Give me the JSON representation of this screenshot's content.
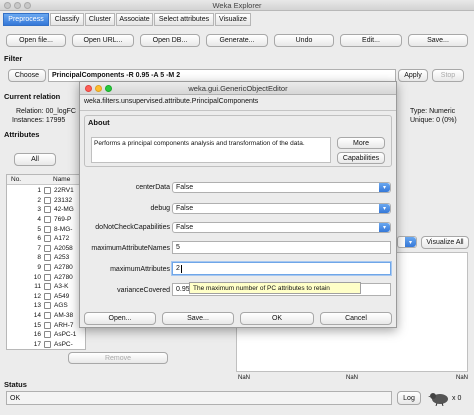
{
  "window_title": "Weka Explorer",
  "tabs": [
    {
      "label": "Preprocess",
      "active": true
    },
    {
      "label": "Classify"
    },
    {
      "label": "Cluster"
    },
    {
      "label": "Associate"
    },
    {
      "label": "Select attributes"
    },
    {
      "label": "Visualize"
    }
  ],
  "toolbar": {
    "open_file": "Open file...",
    "open_url": "Open URL...",
    "open_db": "Open DB...",
    "generate": "Generate...",
    "undo": "Undo",
    "edit": "Edit...",
    "save": "Save..."
  },
  "filter": {
    "section": "Filter",
    "choose": "Choose",
    "value": "PrincipalComponents -R 0.95 -A 5 -M 2",
    "apply": "Apply",
    "stop": "Stop"
  },
  "current_relation": {
    "section": "Current relation",
    "relation": "Relation: 00_logFC",
    "instances": "Instances: 17995"
  },
  "selected_attr": {
    "type": "Type: Numeric",
    "unique": "Unique: 0 (0%)"
  },
  "attributes": {
    "section": "Attributes",
    "all": "All",
    "col_no": "No.",
    "col_name": "Name",
    "rows": [
      {
        "no": "1",
        "name": "22RV1"
      },
      {
        "no": "2",
        "name": "23132"
      },
      {
        "no": "3",
        "name": "42-MG"
      },
      {
        "no": "4",
        "name": "769-P"
      },
      {
        "no": "5",
        "name": "8-MG-"
      },
      {
        "no": "6",
        "name": "A172"
      },
      {
        "no": "7",
        "name": "A2058"
      },
      {
        "no": "8",
        "name": "A253"
      },
      {
        "no": "9",
        "name": "A2780"
      },
      {
        "no": "10",
        "name": "A2780"
      },
      {
        "no": "11",
        "name": "A3-K"
      },
      {
        "no": "12",
        "name": "A549"
      },
      {
        "no": "13",
        "name": "AGS"
      },
      {
        "no": "14",
        "name": "AM-38"
      },
      {
        "no": "15",
        "name": "ARH-7"
      },
      {
        "no": "16",
        "name": "AsPC-1"
      },
      {
        "no": "17",
        "name": "AsPC-"
      }
    ],
    "remove": "Remove"
  },
  "visualize_all": "Visualize All",
  "axis_labels": [
    "NaN",
    "NaN",
    "NaN"
  ],
  "status": {
    "section": "Status",
    "text": "OK",
    "log": "Log",
    "count": "x 0"
  },
  "dialog": {
    "title": "weka.gui.GenericObjectEditor",
    "class_name": "weka.filters.unsupervised.attribute.PrincipalComponents",
    "about_label": "About",
    "about_text": "Performs a principal components analysis and transformation of the data.",
    "more": "More",
    "capabilities": "Capabilities",
    "params": {
      "centerData": {
        "label": "centerData",
        "value": "False"
      },
      "debug": {
        "label": "debug",
        "value": "False"
      },
      "doNotCheckCapabilities": {
        "label": "doNotCheckCapabilities",
        "value": "False"
      },
      "maximumAttributeNames": {
        "label": "maximumAttributeNames",
        "value": "5"
      },
      "maximumAttributes": {
        "label": "maximumAttributes",
        "value": "2"
      },
      "varianceCovered": {
        "label": "varianceCovered",
        "value": "0.95"
      }
    },
    "tooltip": "The maximum number of PC attributes to retain",
    "open": "Open...",
    "save": "Save...",
    "ok": "OK",
    "cancel": "Cancel"
  }
}
